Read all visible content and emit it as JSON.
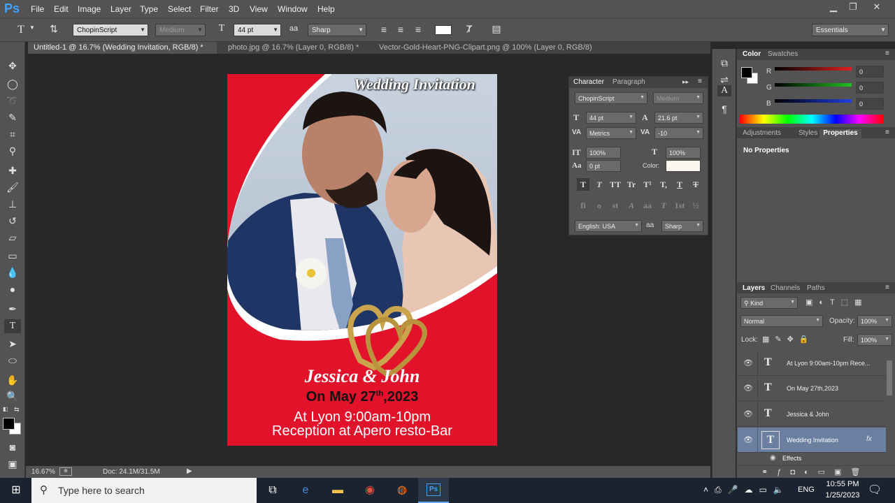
{
  "app": {
    "logo": "Ps",
    "menu": [
      "File",
      "Edit",
      "Image",
      "Layer",
      "Type",
      "Select",
      "Filter",
      "3D",
      "View",
      "Window",
      "Help"
    ]
  },
  "options": {
    "font_family": "ChopinScript",
    "font_style": "Medium",
    "font_size": "44 pt",
    "antialias_label": "a",
    "antialias": "Sharp",
    "workspace": "Essentials"
  },
  "tabs": [
    {
      "label": "Untitled-1 @ 16.7% (Wedding Invitation, RGB/8) *",
      "active": true
    },
    {
      "label": "photo.jpg @ 16.7% (Layer 0, RGB/8) *",
      "active": false
    },
    {
      "label": "Vector-Gold-Heart-PNG-Clipart.png @ 100% (Layer 0, RGB/8)",
      "active": false
    }
  ],
  "invitation": {
    "title": "Wedding Invitation",
    "names": "Jessica & John",
    "date_prefix": "On May 27",
    "date_sup": "th",
    "date_suffix": ",2023",
    "line1": "At Lyon 9:00am-10pm",
    "line2": "Reception at Apero resto-Bar"
  },
  "status": {
    "zoom": "16.67%",
    "doc": "Doc: 24.1M/31.5M"
  },
  "character": {
    "tab_character": "Character",
    "tab_paragraph": "Paragraph",
    "font_family": "ChopinScript",
    "font_style": "Medium",
    "size": "44 pt",
    "leading": "21.6 pt",
    "kerning": "Metrics",
    "tracking": "-10",
    "vscale": "100%",
    "hscale": "100%",
    "baseline": "0 pt",
    "color_label": "Color:",
    "language": "English: USA",
    "aa_label": "a",
    "aa": "Sharp",
    "glyphs1": [
      "T",
      "T",
      "TT",
      "Tr",
      "T¹",
      "T,",
      "T",
      "T"
    ],
    "glyphs2": [
      "fi",
      "ℴ",
      "st",
      "A",
      "aa",
      "T",
      "1st",
      "½"
    ]
  },
  "color_panel": {
    "tab_color": "Color",
    "tab_swatches": "Swatches",
    "channels": [
      {
        "label": "R",
        "value": "0",
        "color": "#e02020"
      },
      {
        "label": "G",
        "value": "0",
        "color": "#20c020"
      },
      {
        "label": "B",
        "value": "0",
        "color": "#2040e0"
      }
    ]
  },
  "adjustments": {
    "tabs": [
      "Adjustments",
      "Styles",
      "Properties"
    ],
    "message": "No Properties"
  },
  "layers": {
    "tabs": [
      "Layers",
      "Channels",
      "Paths"
    ],
    "kind": "Kind",
    "blend": "Normal",
    "opacity_label": "Opacity:",
    "opacity": "100%",
    "lock_label": "Lock:",
    "fill_label": "Fill:",
    "fill": "100%",
    "items": [
      {
        "name": "At Lyon 9:00am-10pm Rece...",
        "selected": false
      },
      {
        "name": "On May 27th,2023",
        "selected": false
      },
      {
        "name": "Jessica & John",
        "selected": false
      },
      {
        "name": "Wedding Invitation",
        "selected": true
      }
    ],
    "effects": "Effects",
    "fx": "fx"
  },
  "taskbar": {
    "search_placeholder": "Type here to search",
    "time": "10:55 PM",
    "date": "1/25/2023",
    "lang": "ENG",
    "ps_label": "Ps"
  },
  "colors": {
    "invitation_red": "#e3122b",
    "gold": "#c9a44c",
    "selected_layer": "#6b7fa0"
  }
}
